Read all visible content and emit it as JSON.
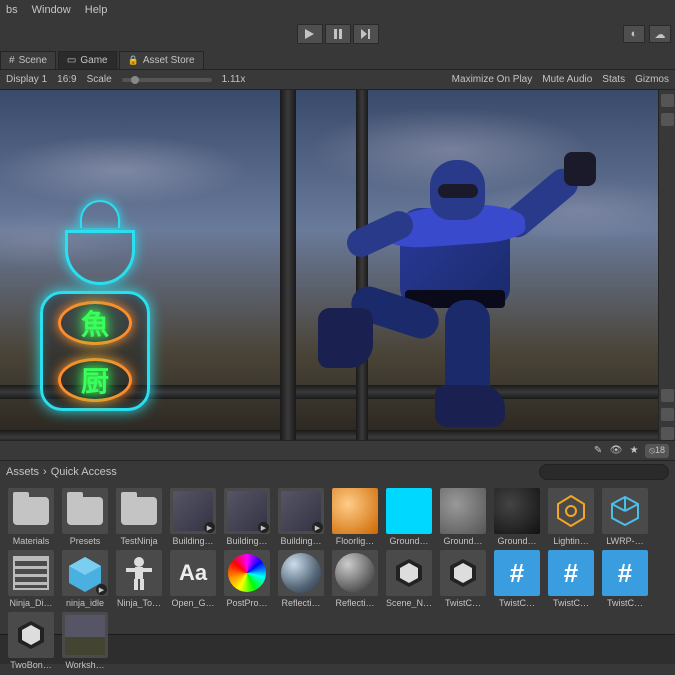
{
  "menu": {
    "items": [
      "bs",
      "Window",
      "Help"
    ]
  },
  "tabs": {
    "scene": "Scene",
    "game": "Game",
    "store": "Asset Store"
  },
  "game_toolbar": {
    "display": "Display 1",
    "aspect": "16:9",
    "scale_label": "Scale",
    "scale_value": "1.11x",
    "maximize": "Maximize On Play",
    "mute": "Mute Audio",
    "stats": "Stats",
    "gizmos": "Gizmos"
  },
  "breadcrumb": {
    "root": "Assets",
    "current": "Quick Access",
    "count": "18"
  },
  "assets": {
    "row1": [
      {
        "label": "Materials",
        "kind": "folder"
      },
      {
        "label": "Presets",
        "kind": "folder"
      },
      {
        "label": "TestNinja",
        "kind": "folder"
      },
      {
        "label": "Building…",
        "kind": "prefab"
      },
      {
        "label": "Building…",
        "kind": "prefab"
      },
      {
        "label": "Building…",
        "kind": "prefab"
      },
      {
        "label": "Floorlig…",
        "kind": "mat-orange"
      },
      {
        "label": "Ground…",
        "kind": "mat-cyan"
      },
      {
        "label": "Ground…",
        "kind": "mat-gray"
      },
      {
        "label": "Ground…",
        "kind": "mat-dark"
      },
      {
        "label": "Lightin…",
        "kind": "settings"
      },
      {
        "label": "LWRP-…",
        "kind": "cube"
      },
      {
        "label": "Ninja_Di…",
        "kind": "film"
      }
    ],
    "row2": [
      {
        "label": "ninja_idle",
        "kind": "box"
      },
      {
        "label": "Ninja_To…",
        "kind": "person"
      },
      {
        "label": "Open_G…",
        "kind": "font"
      },
      {
        "label": "PostPro…",
        "kind": "rainbow"
      },
      {
        "label": "Reflecti…",
        "kind": "sphere1"
      },
      {
        "label": "Reflecti…",
        "kind": "sphere2"
      },
      {
        "label": "Scene_N…",
        "kind": "unity"
      },
      {
        "label": "TwistC…",
        "kind": "unity"
      },
      {
        "label": "TwistC…",
        "kind": "hash"
      },
      {
        "label": "TwistC…",
        "kind": "hash"
      },
      {
        "label": "TwistC…",
        "kind": "hash"
      },
      {
        "label": "TwoBon…",
        "kind": "unity"
      },
      {
        "label": "Worksh…",
        "kind": "scene"
      }
    ]
  }
}
